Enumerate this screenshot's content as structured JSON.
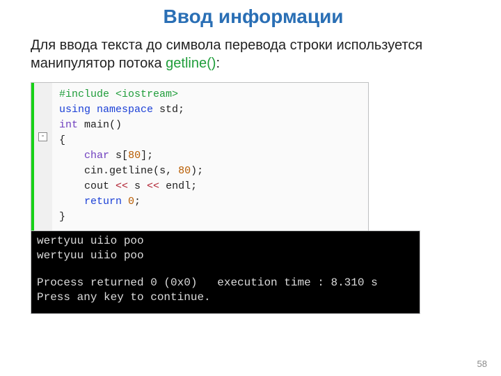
{
  "title": "Ввод информации",
  "desc_prefix": "Для ввода текста до символа перевода строки используется манипулятор потока ",
  "desc_highlight": "getline()",
  "desc_suffix": ":",
  "code": {
    "l1_a": "#include ",
    "l1_b": "<iostream>",
    "l2_a": "using ",
    "l2_b": "namespace ",
    "l2_c": "std",
    "l2_d": ";",
    "l3_a": "int ",
    "l3_b": "main",
    "l3_c": "()",
    "l4": "{",
    "l5_a": "    ",
    "l5_b": "char ",
    "l5_c": "s",
    "l5_d": "[",
    "l5_e": "80",
    "l5_f": "];",
    "l6_a": "    cin",
    "l6_b": ".",
    "l6_c": "getline",
    "l6_d": "(",
    "l6_e": "s",
    "l6_f": ", ",
    "l6_g": "80",
    "l6_h": ");",
    "l7_a": "    cout ",
    "l7_b": "<< ",
    "l7_c": "s ",
    "l7_d": "<< ",
    "l7_e": "endl",
    "l7_f": ";",
    "l8_a": "    ",
    "l8_b": "return ",
    "l8_c": "0",
    "l8_d": ";",
    "l9": "}"
  },
  "fold_symbol": "-",
  "console": {
    "line1": "wertyuu uiio poo",
    "line2": "wertyuu uiio poo",
    "line3": "Process returned 0 (0x0)   execution time : 8.310 s",
    "line4": "Press any key to continue."
  },
  "page_number": "58"
}
